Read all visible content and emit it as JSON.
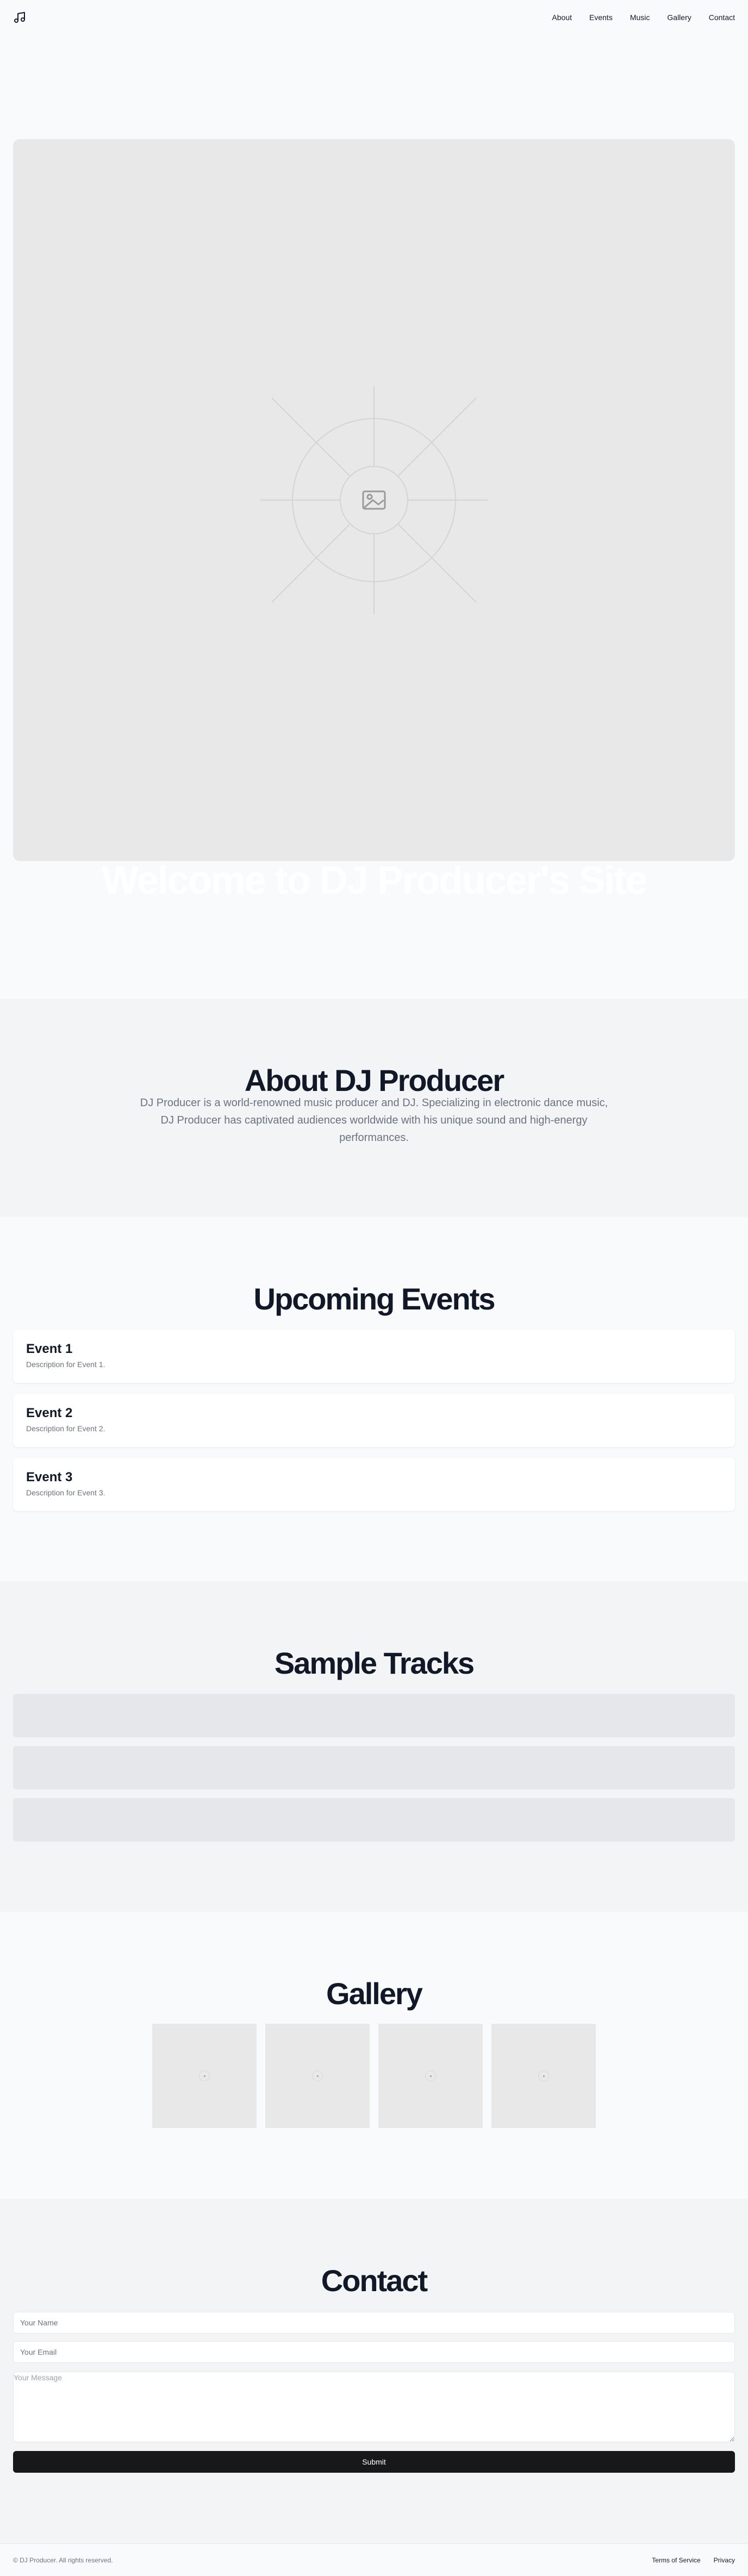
{
  "header": {
    "logo_icon": "music-note-icon",
    "nav": [
      {
        "label": "About"
      },
      {
        "label": "Events"
      },
      {
        "label": "Music"
      },
      {
        "label": "Gallery"
      },
      {
        "label": "Contact"
      }
    ]
  },
  "hero": {
    "image_icon": "image-placeholder-icon",
    "title": "Welcome to DJ Producer's Site"
  },
  "about": {
    "title": "About DJ Producer",
    "text": "DJ Producer is a world-renowned music producer and DJ. Specializing in electronic dance music, DJ Producer has captivated audiences worldwide with his unique sound and high-energy performances."
  },
  "events": {
    "title": "Upcoming Events",
    "items": [
      {
        "name": "Event 1",
        "description": "Description for Event 1."
      },
      {
        "name": "Event 2",
        "description": "Description for Event 2."
      },
      {
        "name": "Event 3",
        "description": "Description for Event 3."
      }
    ]
  },
  "music": {
    "title": "Sample Tracks",
    "track_count": 3
  },
  "gallery": {
    "title": "Gallery",
    "image_count": 4
  },
  "contact": {
    "title": "Contact",
    "name_placeholder": "Your Name",
    "email_placeholder": "Your Email",
    "message_placeholder": "Your Message",
    "submit_label": "Submit"
  },
  "footer": {
    "copyright": "© DJ Producer. All rights reserved.",
    "links": [
      {
        "label": "Terms of Service"
      },
      {
        "label": "Privacy"
      }
    ]
  },
  "colors": {
    "page_bg": "#f9fafb",
    "section_alt_bg": "#f3f4f6",
    "button_bg": "#18181b",
    "muted_text": "#6b7280"
  }
}
